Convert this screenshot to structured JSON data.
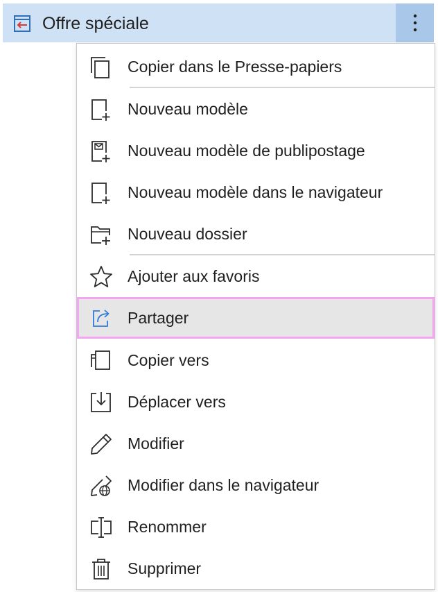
{
  "header": {
    "title": "Offre spéciale",
    "icon": "form-return-icon",
    "more_icon": "more-vertical-icon"
  },
  "menu": {
    "items": [
      {
        "label": "Copier dans le Presse-papiers",
        "icon": "copy-icon"
      },
      {
        "label": "Nouveau modèle",
        "icon": "new-template-icon"
      },
      {
        "label": "Nouveau modèle de publipostage",
        "icon": "new-mail-merge-template-icon"
      },
      {
        "label": "Nouveau modèle dans le navigateur",
        "icon": "new-template-browser-icon"
      },
      {
        "label": "Nouveau dossier",
        "icon": "new-folder-icon"
      },
      {
        "label": "Ajouter aux favoris",
        "icon": "star-icon"
      },
      {
        "label": "Partager",
        "icon": "share-icon",
        "selected": true
      },
      {
        "label": "Copier vers",
        "icon": "copy-to-icon"
      },
      {
        "label": "Déplacer vers",
        "icon": "move-to-icon"
      },
      {
        "label": "Modifier",
        "icon": "pencil-icon"
      },
      {
        "label": "Modifier dans le navigateur",
        "icon": "pencil-globe-icon"
      },
      {
        "label": "Renommer",
        "icon": "rename-icon"
      },
      {
        "label": "Supprimer",
        "icon": "trash-icon"
      }
    ]
  },
  "colors": {
    "header_bg": "#cfe2f5",
    "more_button_bg": "#a9c8e9",
    "selected_bg": "#e6e6e6",
    "selected_outline": "#f3a6f0",
    "share_icon": "#2f7bd8",
    "header_icon_accent": "#d63a3a"
  }
}
